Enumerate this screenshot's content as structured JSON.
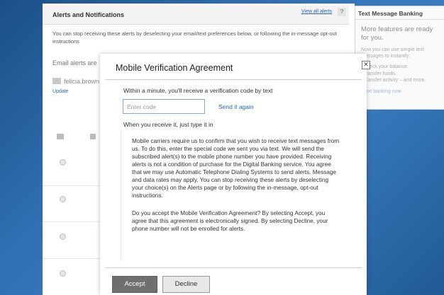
{
  "alerts": {
    "title": "Alerts and Notifications",
    "view_all_label": "View all alerts",
    "help_label": "?",
    "description": "You can stop receiving these alerts by deselecting your email/text preferences below, or following the in-message opt-out instructions",
    "email_alerts_label": "Email alerts are",
    "email_address": "felicia.brown",
    "update_label": "Update"
  },
  "right_panel": {
    "title": "Text Message Banking",
    "more_features": "More features are ready for you.",
    "now_text": "Now you can use simple text messages to instantly:",
    "items": [
      "Check your balance.",
      "Transfer funds.",
      "Transfer activity – and more."
    ],
    "link_label": "text banking now"
  },
  "modal": {
    "title": "Mobile Verification Agreement",
    "close_label": "✕",
    "intro": "Within a minute, you'll receive a verification code by text",
    "code_placeholder": "Enter code",
    "send_again_label": "Send it again",
    "when_text": "When you receive it, just type it in",
    "terms_p1": "Mobile carriers require us to confirm that you wish to receive text messages from us. To do this, enter the special code we sent you via text. We will send the subscribed alert(s) to the mobile phone number you have provided.  Receiving alerts is not a condition of purchase for the Digital Banking service.  You agree that we may use Automatic Telephone Dialing Systems to send alerts. Message and data rates may apply.  You can stop receiving these alerts by deselecting your choice(s) on the Alerts page or by following the in-message, opt-out instructions.",
    "terms_p2": "Do you accept the Mobile Verification Agreement? By selecting Accept, you agree that this agreement is electronically signed. By selecting Decline, your phone number will not be enrolled for alerts.",
    "accept_label": "Accept",
    "decline_label": "Decline"
  },
  "icons": [
    "close-icon",
    "mail-icon",
    "chat-icon"
  ],
  "colors": {
    "link": "#2a66b6",
    "accept_bg": "#6f6f6f",
    "background": "#2f6fb1"
  }
}
